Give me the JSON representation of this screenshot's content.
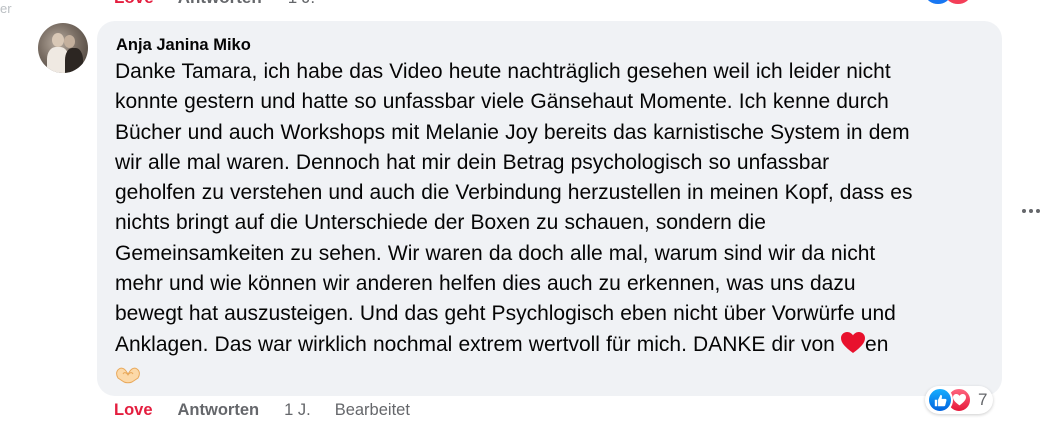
{
  "previous_comment": {
    "love_label": "Love",
    "reply_label": "Antworten",
    "time": "1 J."
  },
  "comment": {
    "author": "Anja Janina Miko",
    "lines": [
      "Danke Tamara, ich habe das Video heute nachträglich gesehen weil ich leider nicht",
      "konnte gestern und hatte so unfassbar viele Gänsehaut Momente. Ich kenne durch",
      "Bücher und auch Workshops mit Melanie Joy bereits das karnistische System in dem",
      "wir alle mal waren. Dennoch hat mir dein Betrag psychologisch so unfassbar",
      "geholfen zu verstehen und auch die Verbindung herzustellen in meinen Kopf, dass es",
      "nichts bringt auf die Unterschiede der Boxen zu schauen, sondern die",
      "Gemeinsamkeiten zu sehen. Wir waren da doch alle mal, warum sind wir da nicht",
      "mehr und wie können wir anderen helfen dies auch zu erkennen, was uns dazu",
      "bewegt hat auszusteigen. Und das geht Psychlogisch eben nicht über Vorwürfe und",
      "Anklagen. Das war wirklich nochmal extrem wertvoll für mich. DANKE dir von"
    ],
    "last_line_suffix": "en",
    "emojis": [
      "red-heart",
      "heart-hands"
    ],
    "reaction_icons": [
      "like",
      "love"
    ],
    "reaction_count": "7",
    "actions": {
      "love_label": "Love",
      "reply_label": "Antworten",
      "time": "1 J.",
      "edited_label": "Bearbeitet"
    }
  },
  "colors": {
    "bubble_bg": "#f0f2f5",
    "love_red": "#e41e3f",
    "secondary_text": "#65676b",
    "like_blue": "#1877f2"
  }
}
